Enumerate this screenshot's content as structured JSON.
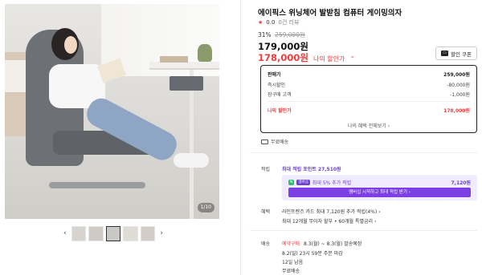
{
  "product": {
    "title": "에이픽스 위닝체어 발받침 컴퓨터 게이밍의자",
    "rating": "0.0",
    "review_count": "0건 리뷰",
    "discount_rate": "31%",
    "original_price": "259,000원",
    "price": "179,000원",
    "my_price": "178,000원",
    "my_price_label": "나의 할인가",
    "coupon_button": "할인 쿠폰",
    "image_counter": "1/10"
  },
  "breakdown": {
    "rows": [
      {
        "label": "판매가",
        "value": "259,000원"
      },
      {
        "label": "즉시할인",
        "value": "-80,000원"
      },
      {
        "label": "장구매 고객",
        "value": "-1,000원"
      }
    ],
    "total_label": "나의 할인가",
    "total_value": "178,000원",
    "more_link": "나의 혜택 전체보기 ›"
  },
  "shipping_note": "무료배송",
  "points": {
    "section_label": "적립",
    "max_points": "최대 적립 포인트 27,510원",
    "extra_line": "최대 5% 추가 적립",
    "extra_value": "7,120원",
    "cta": "멤버십 시작하고 최대 적립 받기 ›",
    "chip_a": "N",
    "chip_b": "멤버십"
  },
  "benefit": {
    "section_label": "혜택",
    "line1": "라인프렌즈 카드 최대 7,120원 추가 적립(4%) ›",
    "line2": "최대 12개월 무이자 할부 • 60개월 특별금리 ›"
  },
  "delivery": {
    "section_label": "배송",
    "tag": "예약구매",
    "line1": "8.3(월) ~ 8.3(월) 발송예정",
    "line2": "8.2(일) 23시 59분 주문 마감",
    "line3": "12일 남음",
    "line4": "무료배송"
  },
  "gallery": {
    "prev": "‹",
    "next": "›"
  },
  "colors": {
    "accent_red": "#f03c3c",
    "accent_purple": "#6b3fd6"
  }
}
